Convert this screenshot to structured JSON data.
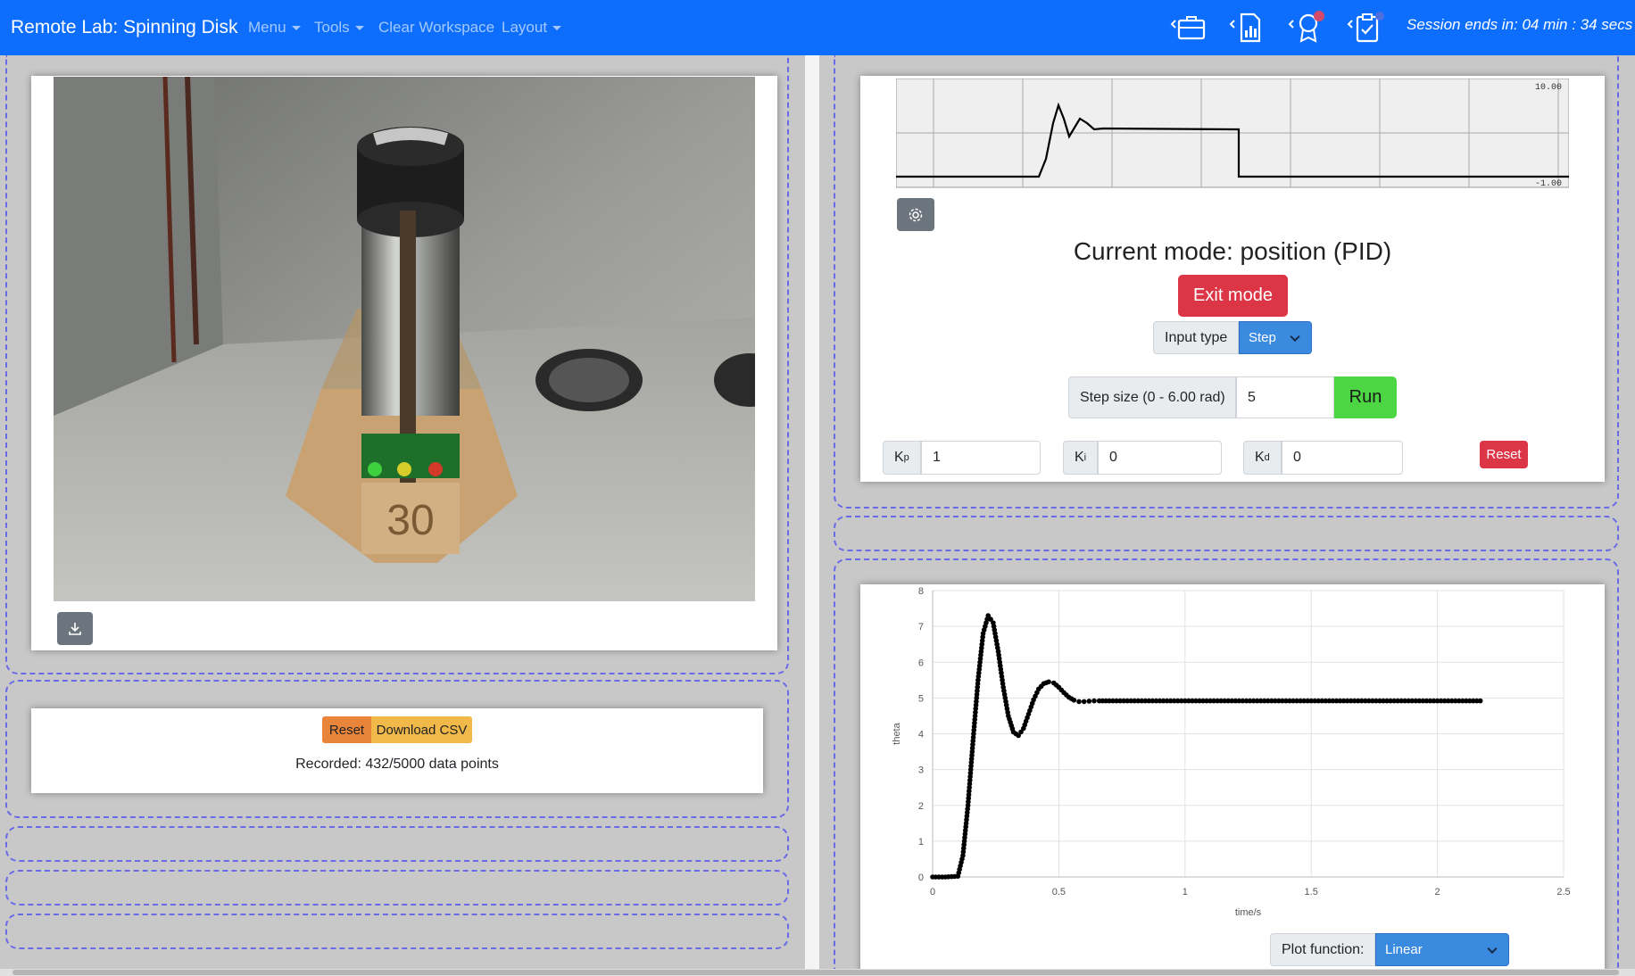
{
  "navbar": {
    "brand": "Remote Lab: Spinning Disk",
    "menu_label": "Menu",
    "tools_label": "Tools",
    "clear_label": "Clear Workspace",
    "layout_label": "Layout",
    "icons": [
      "briefcase-icon",
      "report-chart-icon",
      "achievement-icon",
      "clipboard-check-icon"
    ],
    "session_text": "Session ends in: 04 min : 34 secs",
    "color": "#0d6efd"
  },
  "recorder": {
    "reset_label": "Reset",
    "download_label": "Download CSV",
    "recorded_text": "Recorded: 432/5000 data points"
  },
  "mini_graph": {
    "ymax_label": "10.00",
    "ymin_label": "-1.00"
  },
  "controls": {
    "mode_title": "Current mode: position (PID)",
    "exit_label": "Exit mode",
    "input_type_label": "Input type",
    "input_type_value": "Step",
    "step_label": "Step size (0 - 6.00 rad)",
    "step_value": "5",
    "run_label": "Run",
    "kp_label": "Kp",
    "kp_value": "1",
    "ki_label": "Ki",
    "ki_value": "0",
    "kd_label": "Kd",
    "kd_value": "0",
    "reset_label": "Reset",
    "colors": {
      "exit": "#dc3545",
      "run": "#4cd643",
      "select": "#3a8ae0"
    }
  },
  "plot": {
    "plot_function_label": "Plot function:",
    "plot_function_value": "Linear"
  },
  "chart_data": {
    "type": "scatter",
    "title": "",
    "xlabel": "time/s",
    "ylabel": "theta",
    "xlim": [
      0,
      2.5
    ],
    "ylim": [
      0,
      8
    ],
    "xticks": [
      0,
      0.5,
      1,
      1.5,
      2,
      2.5
    ],
    "yticks": [
      0,
      1,
      2,
      3,
      4,
      5,
      6,
      7,
      8
    ],
    "grid": true,
    "series": [
      {
        "x": [
          0.0,
          0.05,
          0.1,
          0.12,
          0.14,
          0.16,
          0.18,
          0.2,
          0.22,
          0.24,
          0.26,
          0.28,
          0.3,
          0.32,
          0.34,
          0.36,
          0.38,
          0.4,
          0.42,
          0.44,
          0.46,
          0.48,
          0.5,
          0.52,
          0.54,
          0.56,
          0.58,
          0.6,
          0.62,
          0.64,
          0.66,
          0.7,
          0.8,
          0.9,
          1.0,
          1.2,
          1.4,
          1.6,
          1.8,
          2.0,
          2.1,
          2.17
        ],
        "y": [
          0.0,
          0.0,
          0.02,
          0.6,
          2.0,
          3.8,
          5.5,
          6.8,
          7.3,
          7.1,
          6.3,
          5.3,
          4.5,
          4.05,
          3.95,
          4.15,
          4.55,
          4.95,
          5.25,
          5.4,
          5.45,
          5.42,
          5.3,
          5.15,
          5.02,
          4.94,
          4.9,
          4.9,
          4.91,
          4.92,
          4.92,
          4.92,
          4.92,
          4.92,
          4.92,
          4.92,
          4.92,
          4.92,
          4.92,
          4.92,
          4.92,
          4.92
        ]
      }
    ]
  }
}
